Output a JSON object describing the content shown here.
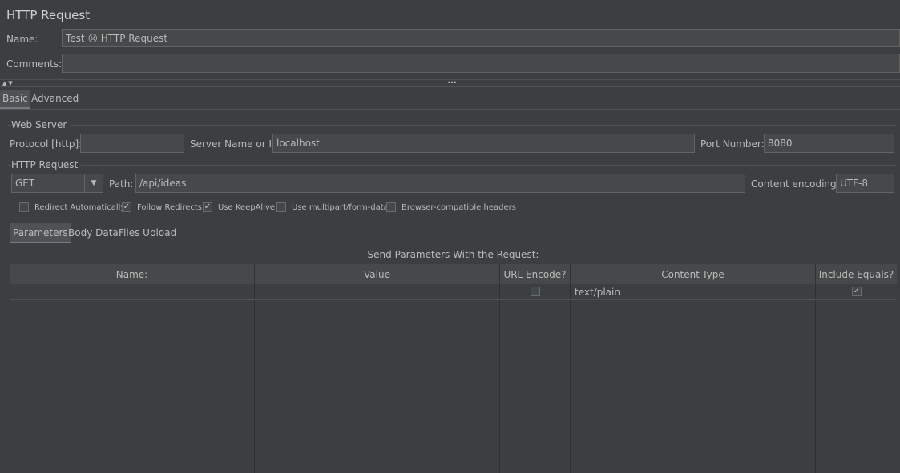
{
  "header": {
    "title": "HTTP Request",
    "name_label": "Name:",
    "name_value": "Test ☹ HTTP Request",
    "comments_label": "Comments:",
    "comments_value": ""
  },
  "tabs": [
    {
      "label": "Basic",
      "selected": true
    },
    {
      "label": "Advanced",
      "selected": false
    }
  ],
  "web_server": {
    "section_label": "Web Server",
    "protocol_label": "Protocol [http]:",
    "protocol_value": "",
    "server_label": "Server Name or IP:",
    "server_value": "localhost",
    "port_label": "Port Number:",
    "port_value": "8080"
  },
  "http_request": {
    "section_label": "HTTP Request",
    "method": "GET",
    "path_label": "Path:",
    "path_value": "/api/ideas",
    "encoding_label": "Content encoding:",
    "encoding_value": "UTF-8"
  },
  "options": [
    {
      "label": "Redirect Automatically",
      "checked": false
    },
    {
      "label": "Follow Redirects",
      "checked": true
    },
    {
      "label": "Use KeepAlive",
      "checked": true
    },
    {
      "label": "Use multipart/form-data",
      "checked": false
    },
    {
      "label": "Browser-compatible headers",
      "checked": false
    }
  ],
  "sub_tabs": [
    {
      "label": "Parameters",
      "selected": true
    },
    {
      "label": "Body Data",
      "selected": false
    },
    {
      "label": "Files Upload",
      "selected": false
    }
  ],
  "params_table": {
    "caption": "Send Parameters With the Request:",
    "columns": [
      "Name:",
      "Value",
      "URL Encode?",
      "Content-Type",
      "Include Equals?"
    ],
    "rows": [
      {
        "name": "",
        "value": "",
        "url_encode": false,
        "content_type": "text/plain",
        "include_equals": true
      }
    ]
  },
  "icons": {
    "checkmark": "✓",
    "collapse": "▲",
    "expand": "▼",
    "splitter": "•••",
    "dropdown": "▼"
  }
}
